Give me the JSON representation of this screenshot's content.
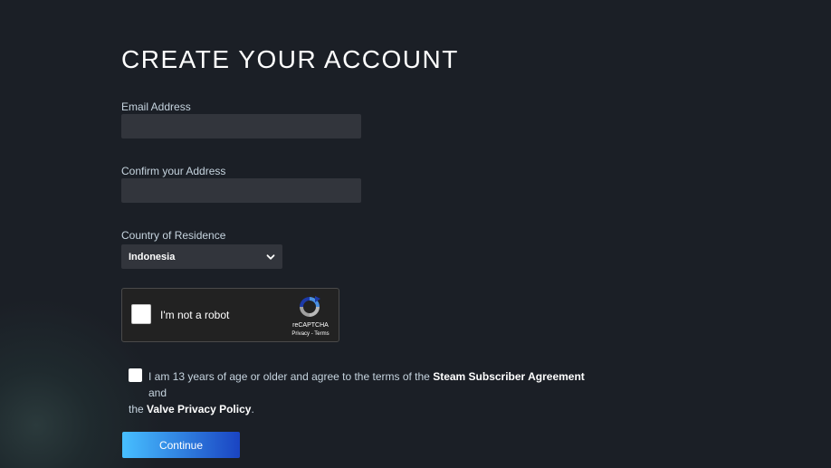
{
  "page": {
    "title": "CREATE YOUR ACCOUNT"
  },
  "form": {
    "email_label": "Email Address",
    "email_value": "",
    "confirm_label": "Confirm your Address",
    "confirm_value": "",
    "country_label": "Country of Residence",
    "country_selected": "Indonesia"
  },
  "recaptcha": {
    "label": "I'm not a robot",
    "brand": "reCAPTCHA",
    "privacy": "Privacy",
    "separator": " - ",
    "terms": "Terms",
    "checked": false
  },
  "agreement": {
    "checked": false,
    "text_before": "I am 13 years of age or older and agree to the terms of the ",
    "subscriber_link": "Steam Subscriber Agreement",
    "text_and": " and",
    "text_the": "the ",
    "privacy_link": "Valve Privacy Policy",
    "text_end": "."
  },
  "actions": {
    "continue_label": "Continue"
  },
  "colors": {
    "background": "#1b1f26",
    "input_bg": "#32353c",
    "button_gradient_start": "#47bfff",
    "button_gradient_end": "#1a44c2"
  },
  "icons": {
    "select_chevron": "chevron-down-icon",
    "recaptcha_logo": "recaptcha-logo-icon"
  }
}
